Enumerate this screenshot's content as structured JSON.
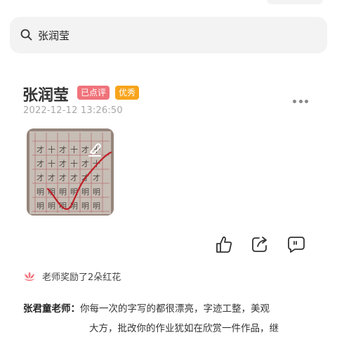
{
  "search": {
    "value": "张润莹",
    "icon": "search-icon"
  },
  "post": {
    "name": "张润莹",
    "badges": {
      "reviewed": "已点评",
      "excellent": "优秀"
    },
    "timestamp": "2022-12-12 13:26:50"
  },
  "reward": {
    "text": "老师奖励了2朵红花",
    "icon": "lotus-icon"
  },
  "comment": {
    "author": "张君童老师：",
    "line1": "你每一次的字写的都很漂亮，字迹工整，美观",
    "line2": "大方，批改你的作业犹如在欣赏一件作品，继"
  },
  "colors": {
    "reviewed_badge": "#f0737b",
    "excellent_badge": "#f8a41c",
    "flower": "#f0737b"
  }
}
